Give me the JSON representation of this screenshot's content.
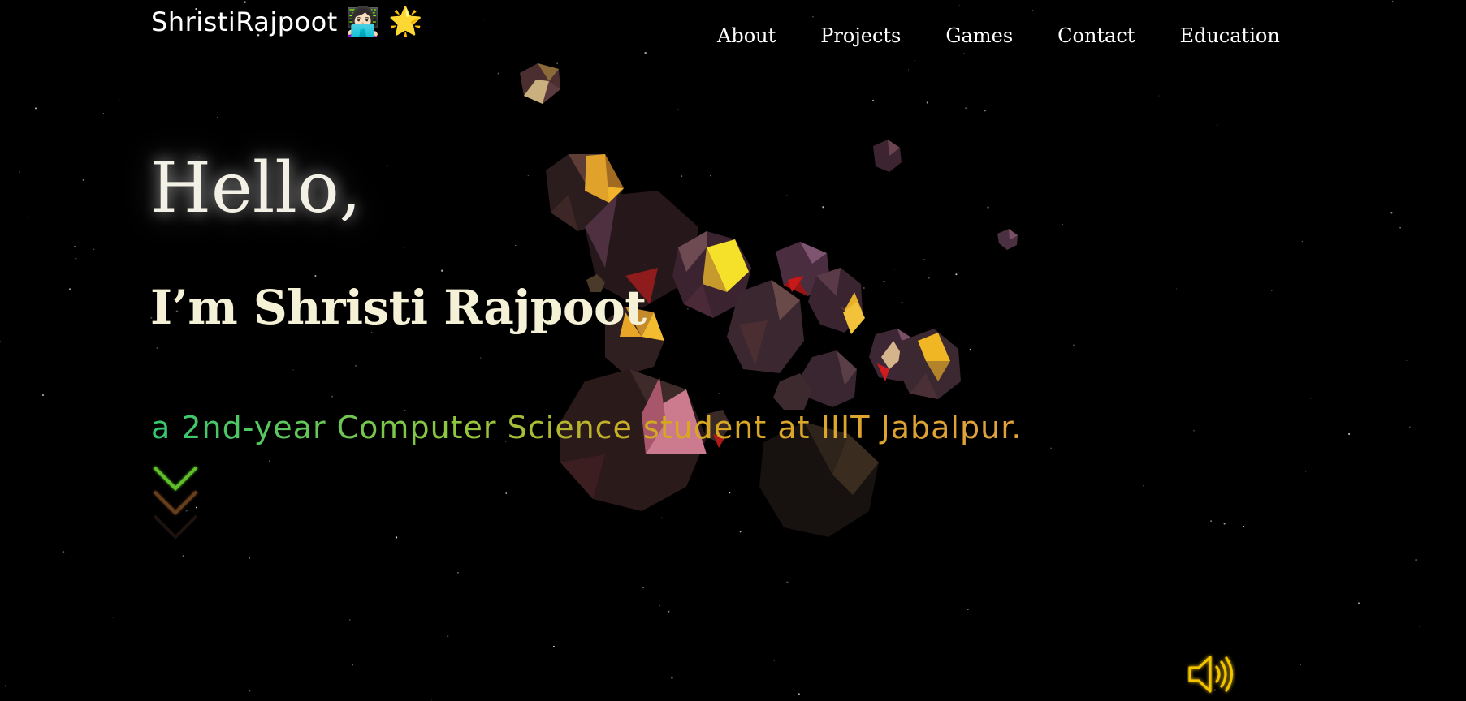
{
  "header": {
    "logo_text": "ShristiRajpoot",
    "logo_emojis": [
      "👩🏻‍💻",
      "🌟"
    ]
  },
  "nav": {
    "items": [
      {
        "label": "About"
      },
      {
        "label": "Projects"
      },
      {
        "label": "Games"
      },
      {
        "label": "Contact"
      },
      {
        "label": "Education"
      }
    ]
  },
  "hero": {
    "greeting": "Hello,",
    "name": "I’m Shristi Rajpoot",
    "tagline": "a 2nd-year Computer Science student at IIIT Jabalpur."
  },
  "icons": {
    "scroll": "chevron-down-icon",
    "sound": "speaker-icon"
  },
  "colors": {
    "background": "#000000",
    "accent_green": "#36c772",
    "accent_gold": "#e1a13f",
    "sound_icon": "#f2c300"
  }
}
